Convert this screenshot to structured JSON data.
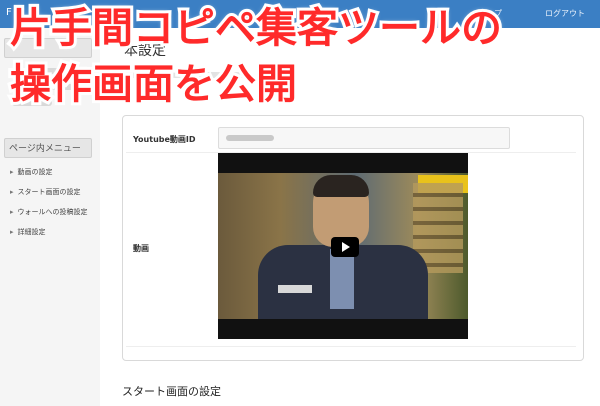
{
  "caption": {
    "line1": "片手間コピペ集客ツールの",
    "line2": "操作画面を公開"
  },
  "navbar": {
    "brand": "F",
    "items": [
      "トップ",
      "ログアウト"
    ]
  },
  "sidebar": {
    "panel_title": "ページ内メニュー",
    "menu": [
      "動画の設定",
      "スタート画面の設定",
      "ウォールへの投稿設定",
      "詳細設定"
    ]
  },
  "main": {
    "heading": "本設定",
    "form": {
      "youtube_label": "Youtube動画ID",
      "video_label": "動画"
    },
    "next_section": "スタート画面の設定"
  },
  "colors": {
    "navbar": "#3b7fc4",
    "caption": "#ff2a2a"
  }
}
